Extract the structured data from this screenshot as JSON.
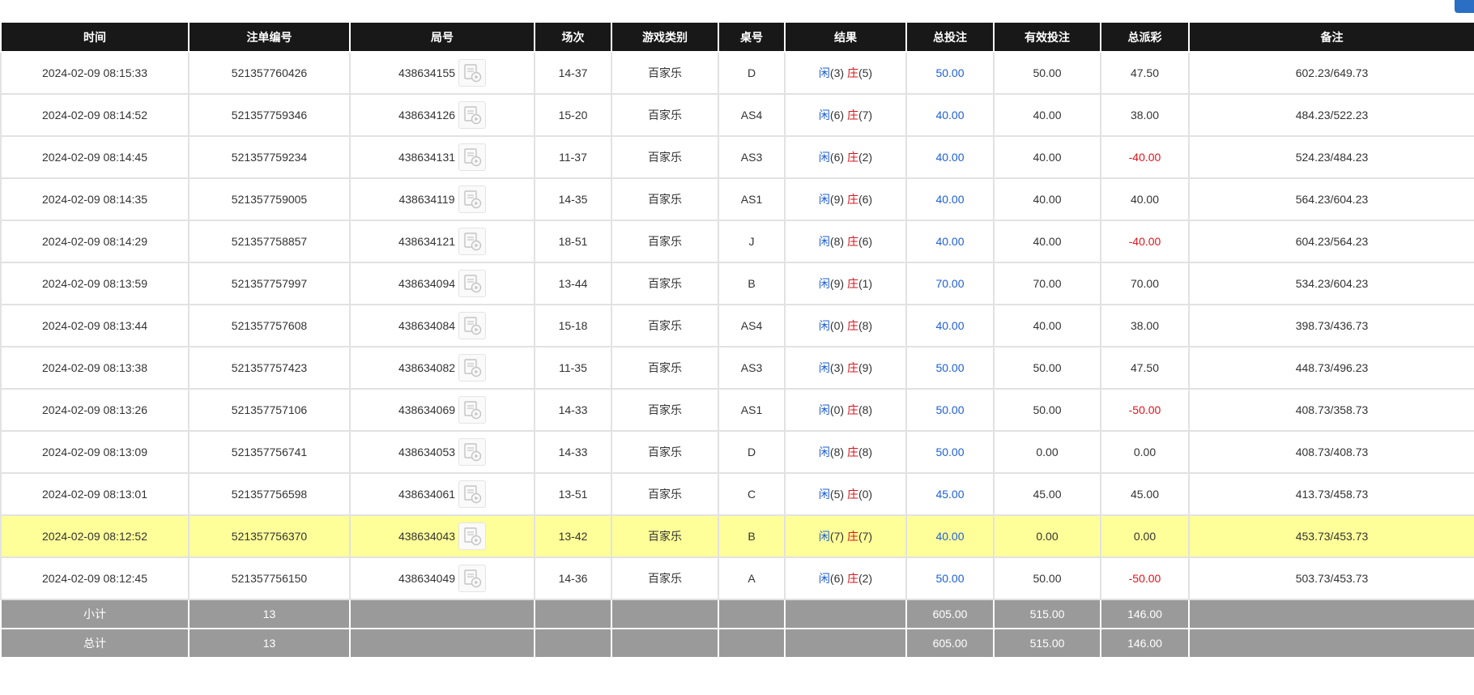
{
  "table": {
    "headers": [
      "时间",
      "注单编号",
      "局号",
      "场次",
      "游戏类别",
      "桌号",
      "结果",
      "总投注",
      "有效投注",
      "总派彩",
      "备注"
    ],
    "rows": [
      {
        "time": "2024-02-09 08:15:33",
        "order_no": "521357760426",
        "game_no": "438634155",
        "session": "14-37",
        "game_type": "百家乐",
        "table_no": "D",
        "player_label": "闲",
        "player_score": "(3)",
        "banker_label": "庄",
        "banker_score": "(5)",
        "total_bet": "50.00",
        "valid_bet": "50.00",
        "payout": "47.50",
        "payout_negative": false,
        "note": "602.23/649.73",
        "highlight": false
      },
      {
        "time": "2024-02-09 08:14:52",
        "order_no": "521357759346",
        "game_no": "438634126",
        "session": "15-20",
        "game_type": "百家乐",
        "table_no": "AS4",
        "player_label": "闲",
        "player_score": "(6)",
        "banker_label": "庄",
        "banker_score": "(7)",
        "total_bet": "40.00",
        "valid_bet": "40.00",
        "payout": "38.00",
        "payout_negative": false,
        "note": "484.23/522.23",
        "highlight": false
      },
      {
        "time": "2024-02-09 08:14:45",
        "order_no": "521357759234",
        "game_no": "438634131",
        "session": "11-37",
        "game_type": "百家乐",
        "table_no": "AS3",
        "player_label": "闲",
        "player_score": "(6)",
        "banker_label": "庄",
        "banker_score": "(2)",
        "total_bet": "40.00",
        "valid_bet": "40.00",
        "payout": "-40.00",
        "payout_negative": true,
        "note": "524.23/484.23",
        "highlight": false
      },
      {
        "time": "2024-02-09 08:14:35",
        "order_no": "521357759005",
        "game_no": "438634119",
        "session": "14-35",
        "game_type": "百家乐",
        "table_no": "AS1",
        "player_label": "闲",
        "player_score": "(9)",
        "banker_label": "庄",
        "banker_score": "(6)",
        "total_bet": "40.00",
        "valid_bet": "40.00",
        "payout": "40.00",
        "payout_negative": false,
        "note": "564.23/604.23",
        "highlight": false
      },
      {
        "time": "2024-02-09 08:14:29",
        "order_no": "521357758857",
        "game_no": "438634121",
        "session": "18-51",
        "game_type": "百家乐",
        "table_no": "J",
        "player_label": "闲",
        "player_score": "(8)",
        "banker_label": "庄",
        "banker_score": "(6)",
        "total_bet": "40.00",
        "valid_bet": "40.00",
        "payout": "-40.00",
        "payout_negative": true,
        "note": "604.23/564.23",
        "highlight": false
      },
      {
        "time": "2024-02-09 08:13:59",
        "order_no": "521357757997",
        "game_no": "438634094",
        "session": "13-44",
        "game_type": "百家乐",
        "table_no": "B",
        "player_label": "闲",
        "player_score": "(9)",
        "banker_label": "庄",
        "banker_score": "(1)",
        "total_bet": "70.00",
        "valid_bet": "70.00",
        "payout": "70.00",
        "payout_negative": false,
        "note": "534.23/604.23",
        "highlight": false
      },
      {
        "time": "2024-02-09 08:13:44",
        "order_no": "521357757608",
        "game_no": "438634084",
        "session": "15-18",
        "game_type": "百家乐",
        "table_no": "AS4",
        "player_label": "闲",
        "player_score": "(0)",
        "banker_label": "庄",
        "banker_score": "(8)",
        "total_bet": "40.00",
        "valid_bet": "40.00",
        "payout": "38.00",
        "payout_negative": false,
        "note": "398.73/436.73",
        "highlight": false
      },
      {
        "time": "2024-02-09 08:13:38",
        "order_no": "521357757423",
        "game_no": "438634082",
        "session": "11-35",
        "game_type": "百家乐",
        "table_no": "AS3",
        "player_label": "闲",
        "player_score": "(3)",
        "banker_label": "庄",
        "banker_score": "(9)",
        "total_bet": "50.00",
        "valid_bet": "50.00",
        "payout": "47.50",
        "payout_negative": false,
        "note": "448.73/496.23",
        "highlight": false
      },
      {
        "time": "2024-02-09 08:13:26",
        "order_no": "521357757106",
        "game_no": "438634069",
        "session": "14-33",
        "game_type": "百家乐",
        "table_no": "AS1",
        "player_label": "闲",
        "player_score": "(0)",
        "banker_label": "庄",
        "banker_score": "(8)",
        "total_bet": "50.00",
        "valid_bet": "50.00",
        "payout": "-50.00",
        "payout_negative": true,
        "note": "408.73/358.73",
        "highlight": false
      },
      {
        "time": "2024-02-09 08:13:09",
        "order_no": "521357756741",
        "game_no": "438634053",
        "session": "14-33",
        "game_type": "百家乐",
        "table_no": "D",
        "player_label": "闲",
        "player_score": "(8)",
        "banker_label": "庄",
        "banker_score": "(8)",
        "total_bet": "50.00",
        "valid_bet": "0.00",
        "payout": "0.00",
        "payout_negative": false,
        "note": "408.73/408.73",
        "highlight": false
      },
      {
        "time": "2024-02-09 08:13:01",
        "order_no": "521357756598",
        "game_no": "438634061",
        "session": "13-51",
        "game_type": "百家乐",
        "table_no": "C",
        "player_label": "闲",
        "player_score": "(5)",
        "banker_label": "庄",
        "banker_score": "(0)",
        "total_bet": "45.00",
        "valid_bet": "45.00",
        "payout": "45.00",
        "payout_negative": false,
        "note": "413.73/458.73",
        "highlight": false
      },
      {
        "time": "2024-02-09 08:12:52",
        "order_no": "521357756370",
        "game_no": "438634043",
        "session": "13-42",
        "game_type": "百家乐",
        "table_no": "B",
        "player_label": "闲",
        "player_score": "(7)",
        "banker_label": "庄",
        "banker_score": "(7)",
        "total_bet": "40.00",
        "valid_bet": "0.00",
        "payout": "0.00",
        "payout_negative": false,
        "note": "453.73/453.73",
        "highlight": true
      },
      {
        "time": "2024-02-09 08:12:45",
        "order_no": "521357756150",
        "game_no": "438634049",
        "session": "14-36",
        "game_type": "百家乐",
        "table_no": "A",
        "player_label": "闲",
        "player_score": "(6)",
        "banker_label": "庄",
        "banker_score": "(2)",
        "total_bet": "50.00",
        "valid_bet": "50.00",
        "payout": "-50.00",
        "payout_negative": true,
        "note": "503.73/453.73",
        "highlight": false
      }
    ],
    "subtotal": {
      "label": "小计",
      "count": "13",
      "total_bet": "605.00",
      "valid_bet": "515.00",
      "payout": "146.00"
    },
    "grand_total": {
      "label": "总计",
      "count": "13",
      "total_bet": "605.00",
      "valid_bet": "515.00",
      "payout": "146.00"
    },
    "replay_icon": "video-replay-icon"
  },
  "colors": {
    "header_bg": "#181818",
    "footer_bg": "#9a9a9a",
    "highlight_row": "#ffff99",
    "player_blue": "#1e5fd6",
    "banker_red": "#d6141c",
    "negative_red": "#e0141c"
  }
}
